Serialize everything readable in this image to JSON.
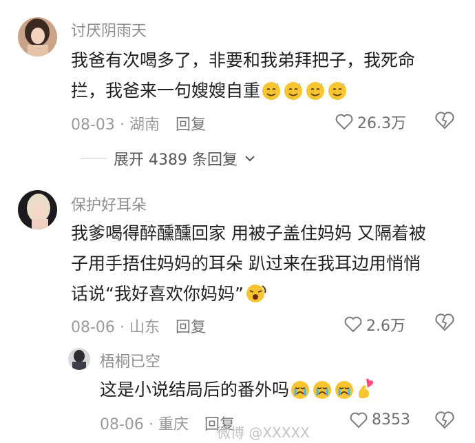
{
  "comments": [
    {
      "username": "讨厌阴雨天",
      "text_line1": "我爸有次喝多了，非要和我弟拜把子，我死命",
      "text_line2": "拦，我爸来一句嫂嫂自重",
      "date": "08-03",
      "location": "湖南",
      "reply_label": "回复",
      "likes": "26.3万",
      "emoji": [
        "smile-sweat",
        "smile-sweat",
        "smile-sweat",
        "smile-sweat"
      ],
      "expand_label": "展开 4389 条回复"
    },
    {
      "username": "保护好耳朵",
      "text_line1": "我爹喝得醉醺醺回家 用被子盖住妈妈 又隔着被",
      "text_line2": "子用手捂住妈妈的耳朵 趴过来在我耳边用悄悄",
      "text_line3": "话说“我好喜欢你妈妈”",
      "date": "08-06",
      "location": "山东",
      "reply_label": "回复",
      "likes": "2.6万",
      "emoji": [
        "yawning-face"
      ]
    }
  ],
  "reply": {
    "username": "梧桐已空",
    "text": "这是小说结局后的番外吗",
    "date": "08-06",
    "location": "重庆",
    "reply_label": "回复",
    "likes": "8353",
    "emoji": [
      "crying-face",
      "crying-face",
      "crying-face",
      "finger-heart"
    ]
  },
  "separator": "·",
  "watermark": "微博 @XXXXX",
  "colors": {
    "text": "#1f1f1f",
    "meta": "#9a9a9a",
    "emoji_yellow": "#f7c531",
    "heart_pink": "#ff4d7a"
  }
}
